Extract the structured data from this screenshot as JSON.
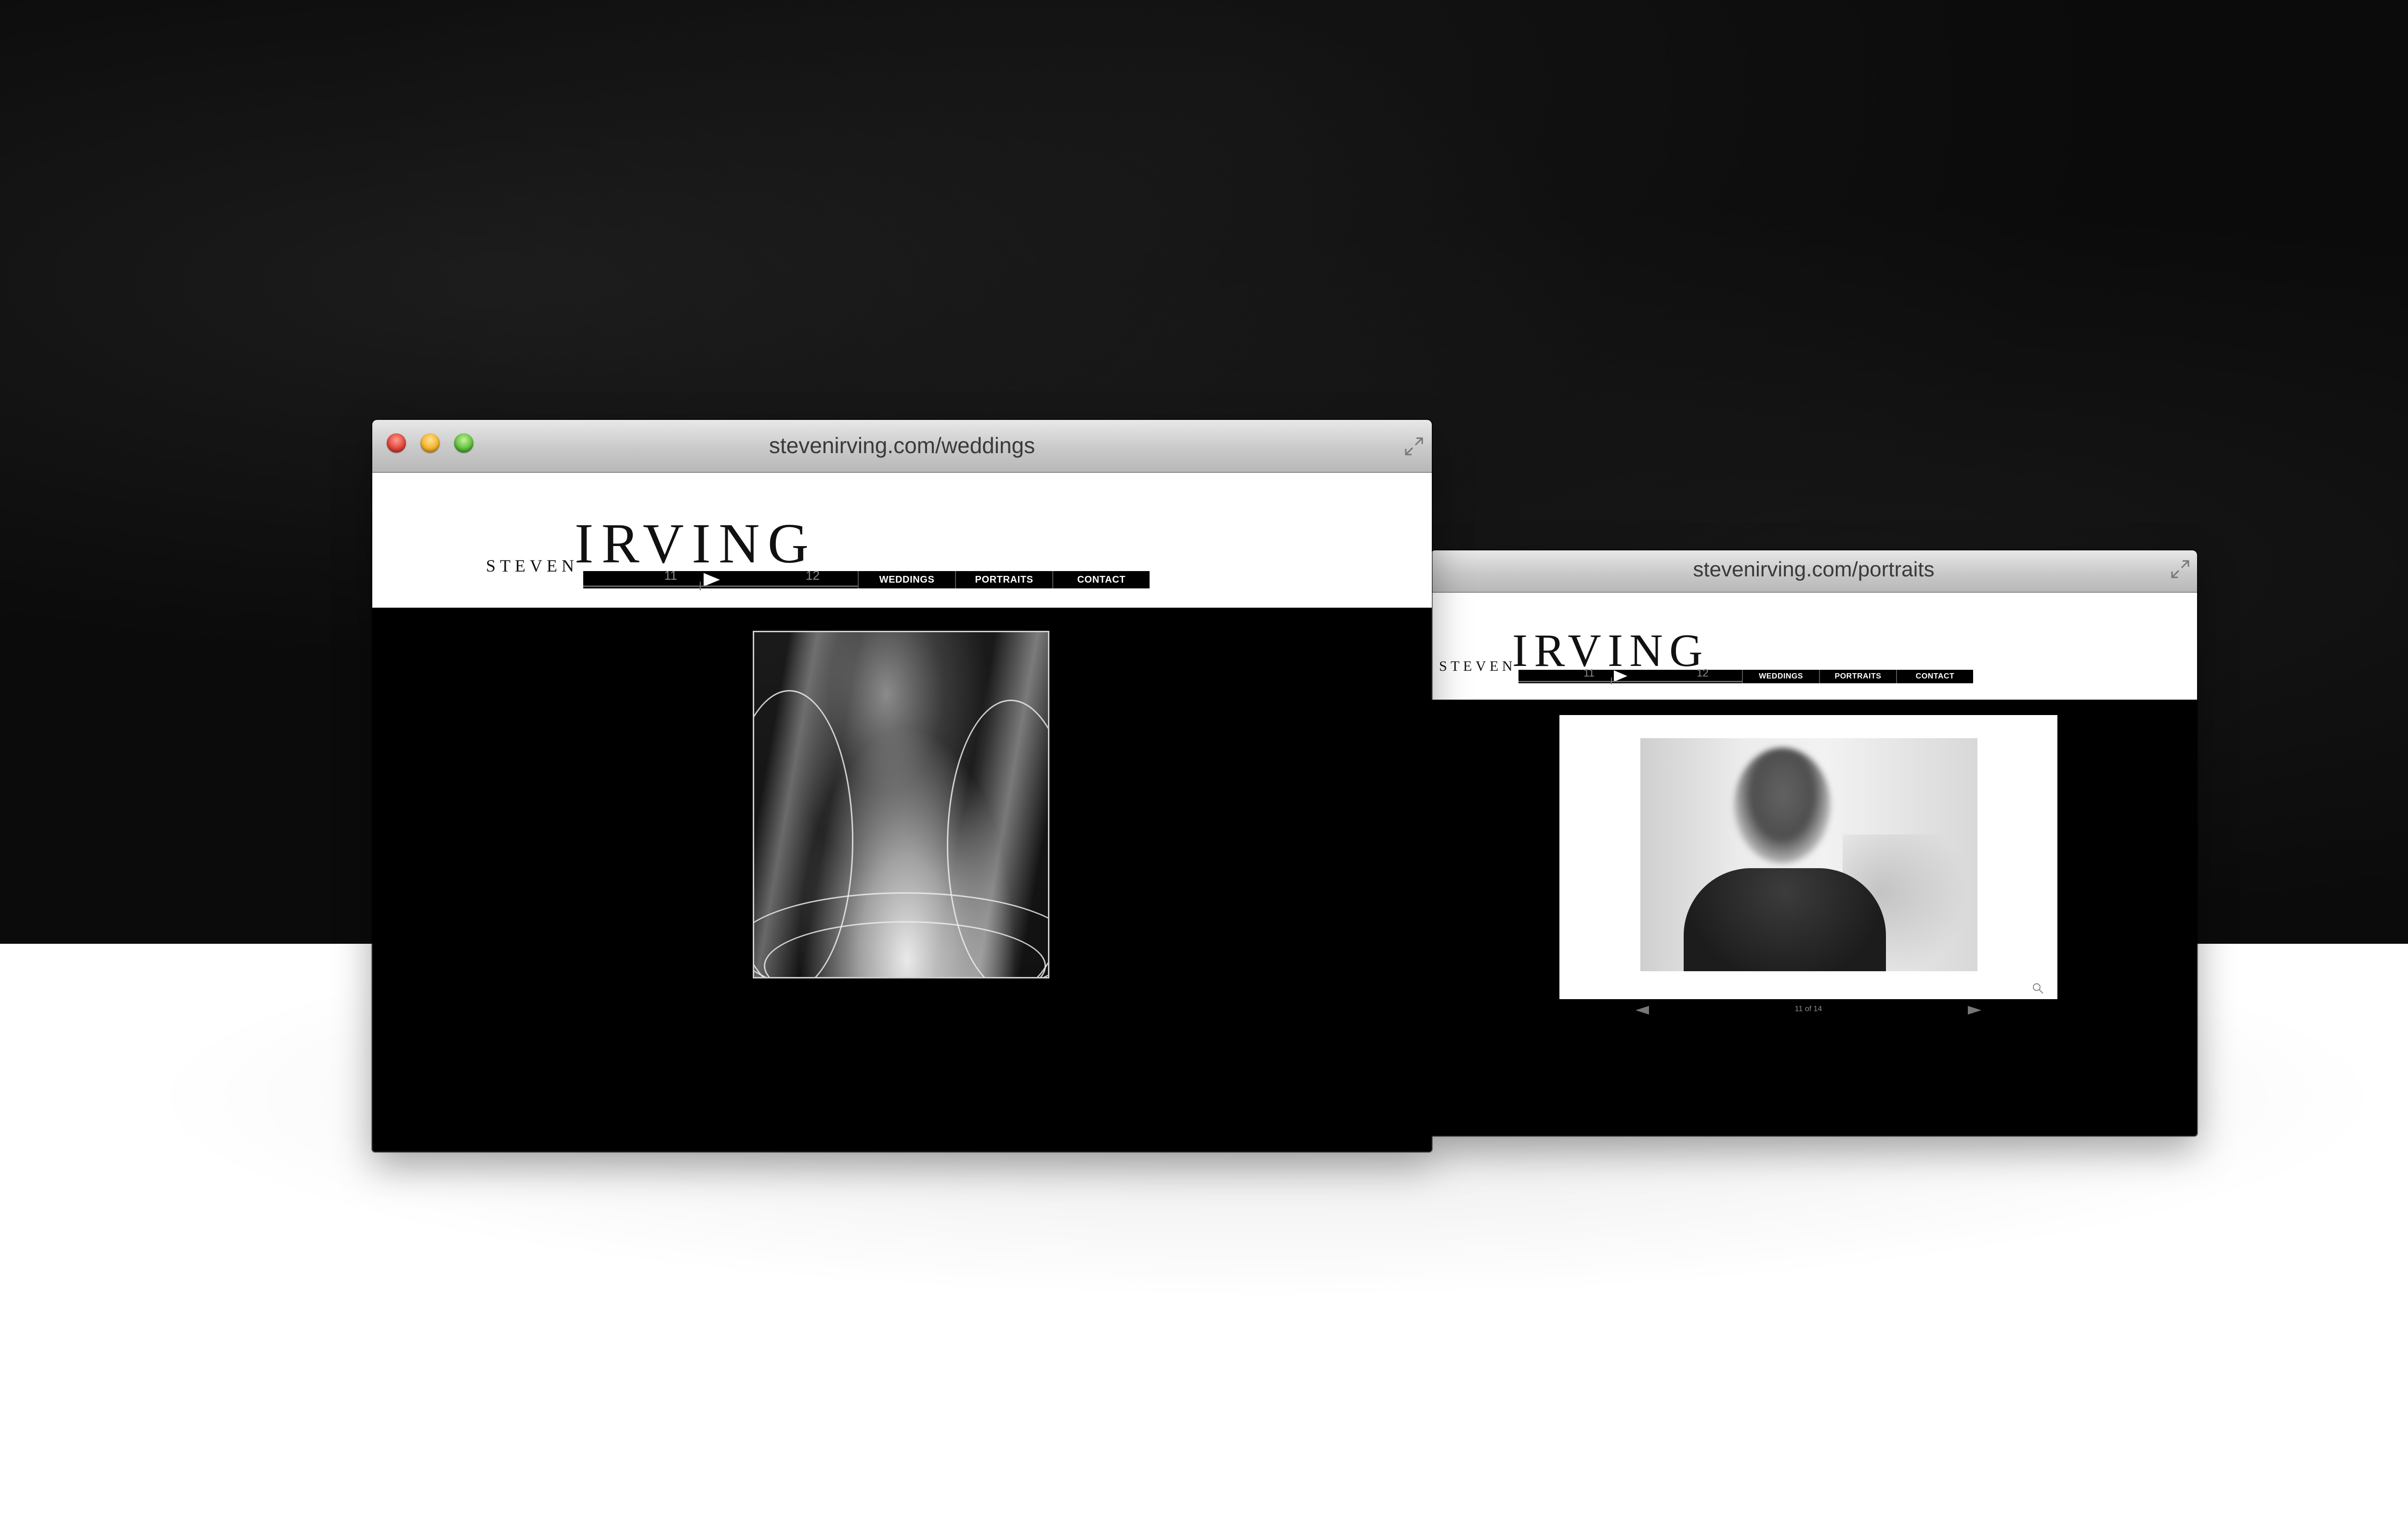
{
  "windows": {
    "weddings": {
      "url": "stevenirving.com/weddings",
      "logo": {
        "first": "STEVEN",
        "last": "IRVING"
      },
      "track": {
        "mark_a": "11",
        "mark_b": "12"
      },
      "nav": [
        "WEDDINGS",
        "PORTRAITS",
        "CONTACT"
      ]
    },
    "portraits": {
      "url": "stevenirving.com/portraits",
      "logo": {
        "first": "STEVEN",
        "last": "IRVING"
      },
      "track": {
        "mark_a": "11",
        "mark_b": "12"
      },
      "nav": [
        "WEDDINGS",
        "PORTRAITS",
        "CONTACT"
      ],
      "gallery": {
        "counter": "11 of 14"
      }
    }
  },
  "icons": {
    "window_controls": [
      "close-icon",
      "minimize-icon",
      "maximize-icon"
    ],
    "fullscreen": "fullscreen-icon",
    "play": "play-icon",
    "zoom": "zoom-icon",
    "prev": "prev-arrow-icon",
    "next": "next-arrow-icon"
  },
  "colors": {
    "backdrop_dark": "#0b0b0b",
    "close": "#e0443a",
    "minimize": "#f2b22a",
    "maximize": "#5ec03a"
  }
}
